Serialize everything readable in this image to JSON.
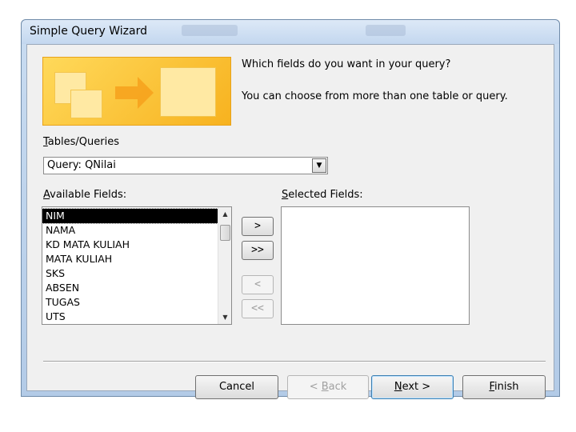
{
  "window": {
    "title": "Simple Query Wizard"
  },
  "intro": {
    "question": "Which fields do you want in your query?",
    "hint": "You can choose from more than one table or query."
  },
  "tables_queries": {
    "label_mnemonic": "T",
    "label_rest": "ables/Queries",
    "selected": "Query: QNilai"
  },
  "available_fields": {
    "label_mnemonic": "A",
    "label_rest": "vailable Fields:",
    "items": [
      "NIM",
      "NAMA",
      "KD MATA KULIAH",
      "MATA KULIAH",
      "SKS",
      "ABSEN",
      "TUGAS",
      "UTS"
    ],
    "selected_index": 0
  },
  "selected_fields": {
    "label_mnemonic": "S",
    "label_rest": "elected Fields:",
    "items": []
  },
  "move_buttons": {
    "add_one": ">",
    "add_all": ">>",
    "remove_one": "<",
    "remove_all": "<<"
  },
  "footer": {
    "cancel": "Cancel",
    "back_prefix": "< ",
    "back_mnemonic": "B",
    "back_rest": "ack",
    "next_mnemonic": "N",
    "next_rest": "ext >",
    "finish_mnemonic": "F",
    "finish_rest": "inish"
  }
}
